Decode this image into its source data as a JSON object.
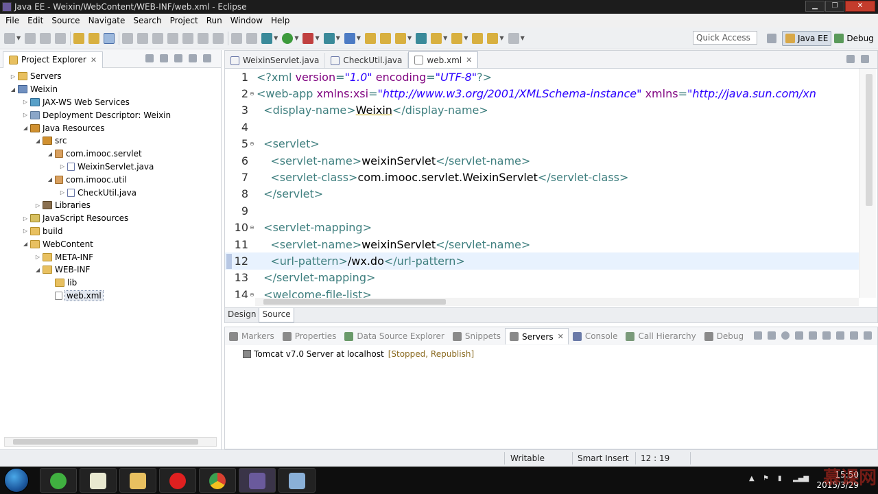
{
  "window": {
    "title": "Java EE - Weixin/WebContent/WEB-INF/web.xml - Eclipse"
  },
  "menubar": [
    "File",
    "Edit",
    "Source",
    "Navigate",
    "Search",
    "Project",
    "Run",
    "Window",
    "Help"
  ],
  "toolbar": {
    "quick_access_placeholder": "Quick Access",
    "perspectives": [
      {
        "label": "Java EE",
        "active": true
      },
      {
        "label": "Debug",
        "active": false
      }
    ]
  },
  "explorer": {
    "title": "Project Explorer",
    "items": [
      {
        "label": "Servers",
        "depth": 0,
        "twisty": "closed",
        "icon": "folder"
      },
      {
        "label": "Weixin",
        "depth": 0,
        "twisty": "open",
        "icon": "project"
      },
      {
        "label": "JAX-WS Web Services",
        "depth": 1,
        "twisty": "closed",
        "icon": "ws"
      },
      {
        "label": "Deployment Descriptor: Weixin",
        "depth": 1,
        "twisty": "closed",
        "icon": "desc"
      },
      {
        "label": "Java Resources",
        "depth": 1,
        "twisty": "open",
        "icon": "jres"
      },
      {
        "label": "src",
        "depth": 2,
        "twisty": "open",
        "icon": "jres"
      },
      {
        "label": "com.imooc.servlet",
        "depth": 3,
        "twisty": "open",
        "icon": "pkg"
      },
      {
        "label": "WeixinServlet.java",
        "depth": 4,
        "twisty": "closed",
        "icon": "java"
      },
      {
        "label": "com.imooc.util",
        "depth": 3,
        "twisty": "open",
        "icon": "pkg"
      },
      {
        "label": "CheckUtil.java",
        "depth": 4,
        "twisty": "closed",
        "icon": "java"
      },
      {
        "label": "Libraries",
        "depth": 2,
        "twisty": "closed",
        "icon": "lib"
      },
      {
        "label": "JavaScript Resources",
        "depth": 1,
        "twisty": "closed",
        "icon": "js"
      },
      {
        "label": "build",
        "depth": 1,
        "twisty": "closed",
        "icon": "folder"
      },
      {
        "label": "WebContent",
        "depth": 1,
        "twisty": "open",
        "icon": "folder"
      },
      {
        "label": "META-INF",
        "depth": 2,
        "twisty": "closed",
        "icon": "folder"
      },
      {
        "label": "WEB-INF",
        "depth": 2,
        "twisty": "open",
        "icon": "folder"
      },
      {
        "label": "lib",
        "depth": 3,
        "twisty": "none",
        "icon": "folder"
      },
      {
        "label": "web.xml",
        "depth": 3,
        "twisty": "none",
        "icon": "xml",
        "selected": true
      }
    ]
  },
  "editor": {
    "tabs": [
      {
        "label": "WeixinServlet.java",
        "active": false
      },
      {
        "label": "CheckUtil.java",
        "active": false
      },
      {
        "label": "web.xml",
        "active": true
      }
    ],
    "lines": [
      {
        "n": "1",
        "fold": "",
        "current": false,
        "parts": [
          [
            "tag",
            "<?xml "
          ],
          [
            "attr",
            "version"
          ],
          [
            "tag",
            "="
          ],
          [
            "str",
            "\"1.0\""
          ],
          [
            "attr",
            " encoding"
          ],
          [
            "tag",
            "="
          ],
          [
            "str",
            "\"UTF-8\""
          ],
          [
            "tag",
            "?>"
          ]
        ]
      },
      {
        "n": "2",
        "fold": "⊖",
        "current": false,
        "parts": [
          [
            "tag",
            "<web-app "
          ],
          [
            "attr",
            "xmlns:xsi"
          ],
          [
            "tag",
            "="
          ],
          [
            "str",
            "\"http://www.w3.org/2001/XMLSchema-instance\""
          ],
          [
            "attr",
            " xmlns"
          ],
          [
            "tag",
            "="
          ],
          [
            "str",
            "\"http://java.sun.com/xn"
          ]
        ]
      },
      {
        "n": "3",
        "fold": "",
        "current": false,
        "parts": [
          [
            "txt",
            "  "
          ],
          [
            "tag",
            "<display-name>"
          ],
          [
            "under",
            "Weixin"
          ],
          [
            "tag",
            "</display-name>"
          ]
        ]
      },
      {
        "n": "4",
        "fold": "",
        "current": false,
        "parts": [
          [
            "txt",
            ""
          ]
        ]
      },
      {
        "n": "5",
        "fold": "⊖",
        "current": false,
        "parts": [
          [
            "txt",
            "  "
          ],
          [
            "tag",
            "<servlet>"
          ]
        ]
      },
      {
        "n": "6",
        "fold": "",
        "current": false,
        "parts": [
          [
            "txt",
            "    "
          ],
          [
            "tag",
            "<servlet-name>"
          ],
          [
            "txt",
            "weixinServlet"
          ],
          [
            "tag",
            "</servlet-name>"
          ]
        ]
      },
      {
        "n": "7",
        "fold": "",
        "current": false,
        "parts": [
          [
            "txt",
            "    "
          ],
          [
            "tag",
            "<servlet-class>"
          ],
          [
            "txt",
            "com.imooc.servlet.WeixinServlet"
          ],
          [
            "tag",
            "</servlet-class>"
          ]
        ]
      },
      {
        "n": "8",
        "fold": "",
        "current": false,
        "parts": [
          [
            "txt",
            "  "
          ],
          [
            "tag",
            "</servlet>"
          ]
        ]
      },
      {
        "n": "9",
        "fold": "",
        "current": false,
        "parts": [
          [
            "txt",
            ""
          ]
        ]
      },
      {
        "n": "10",
        "fold": "⊖",
        "current": false,
        "parts": [
          [
            "txt",
            "  "
          ],
          [
            "tag",
            "<servlet-mapping>"
          ]
        ]
      },
      {
        "n": "11",
        "fold": "",
        "current": false,
        "parts": [
          [
            "txt",
            "    "
          ],
          [
            "tag",
            "<servlet-name>"
          ],
          [
            "txt",
            "weixinServlet"
          ],
          [
            "tag",
            "</servlet-name>"
          ]
        ]
      },
      {
        "n": "12",
        "fold": "",
        "current": true,
        "parts": [
          [
            "txt",
            "    "
          ],
          [
            "tag",
            "<url-pattern>"
          ],
          [
            "txt",
            "/wx.do"
          ],
          [
            "tag",
            "</url-pattern>"
          ]
        ]
      },
      {
        "n": "13",
        "fold": "",
        "current": false,
        "parts": [
          [
            "txt",
            "  "
          ],
          [
            "tag",
            "</servlet-mapping>"
          ]
        ]
      },
      {
        "n": "14",
        "fold": "⊖",
        "current": false,
        "parts": [
          [
            "txt",
            "  "
          ],
          [
            "tag",
            "<welcome-file-list>"
          ]
        ]
      }
    ],
    "mode_tabs": [
      {
        "label": "Design",
        "active": false
      },
      {
        "label": "Source",
        "active": true
      }
    ]
  },
  "bottom": {
    "tabs": [
      {
        "label": "Markers",
        "active": false
      },
      {
        "label": "Properties",
        "active": false
      },
      {
        "label": "Data Source Explorer",
        "active": false
      },
      {
        "label": "Snippets",
        "active": false
      },
      {
        "label": "Servers",
        "active": true
      },
      {
        "label": "Console",
        "active": false
      },
      {
        "label": "Call Hierarchy",
        "active": false
      },
      {
        "label": "Debug",
        "active": false
      }
    ],
    "servers": [
      {
        "name": "Tomcat v7.0 Server at localhost",
        "state": "[Stopped, Republish]"
      }
    ]
  },
  "statusbar": {
    "writable": "Writable",
    "insert_mode": "Smart Insert",
    "position": "12 : 19"
  },
  "taskbar": {
    "time": "15:50",
    "date": "2015/3/29"
  },
  "watermark": "慕课网"
}
